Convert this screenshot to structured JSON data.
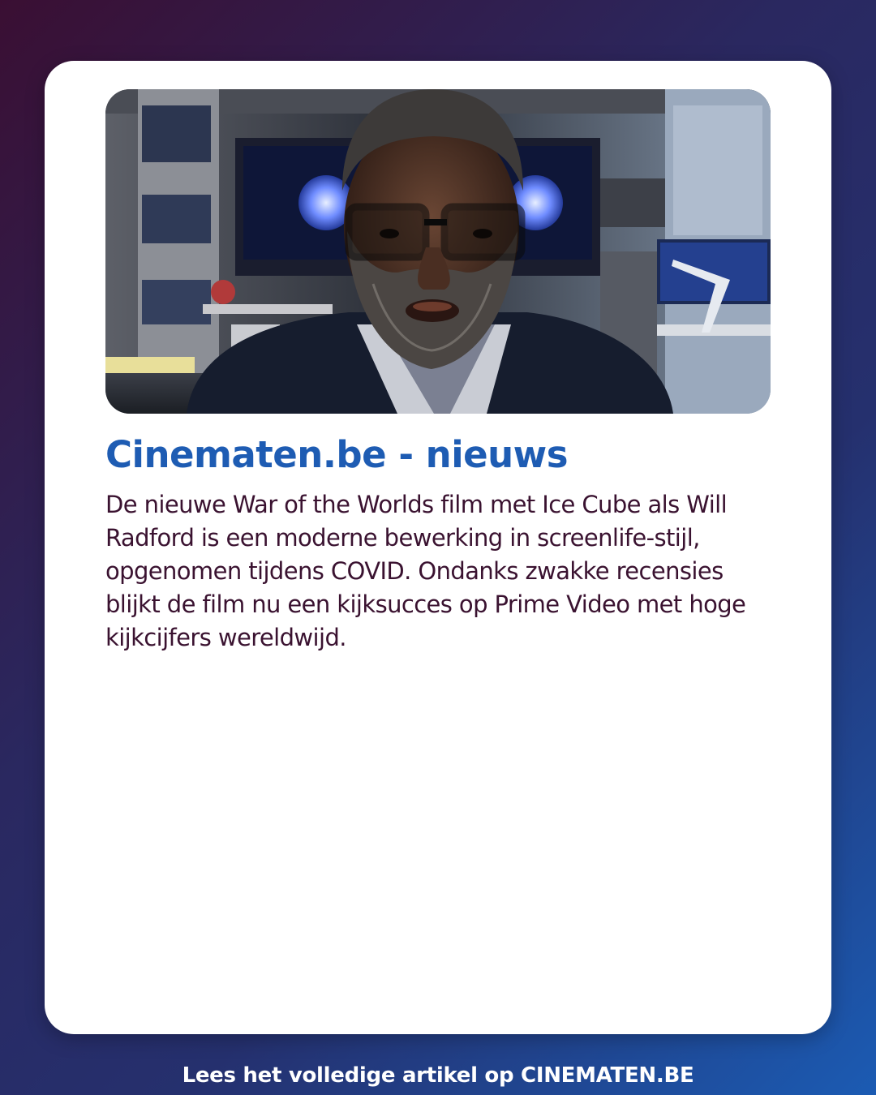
{
  "card": {
    "image_alt": "Ice Cube als Will Radford",
    "title": "Cinematen.be - nieuws",
    "body": "De nieuwe War of the Worlds film met Ice Cube als Will Radford is een moderne bewerking in screenlife-stijl, opgenomen tijdens COVID. Ondanks zwakke recensies blijkt de film nu een kijksucces op Prime Video met hoge kijkcijfers wereldwijd."
  },
  "footer": {
    "text": "Lees het volledige artikel op CINEMATEN.BE"
  },
  "colors": {
    "title": "#1e5cb3",
    "body_text": "#3a1230",
    "card_background": "#ffffff",
    "page_gradient_start": "#3a0f33",
    "page_gradient_end": "#1b5bb3"
  }
}
